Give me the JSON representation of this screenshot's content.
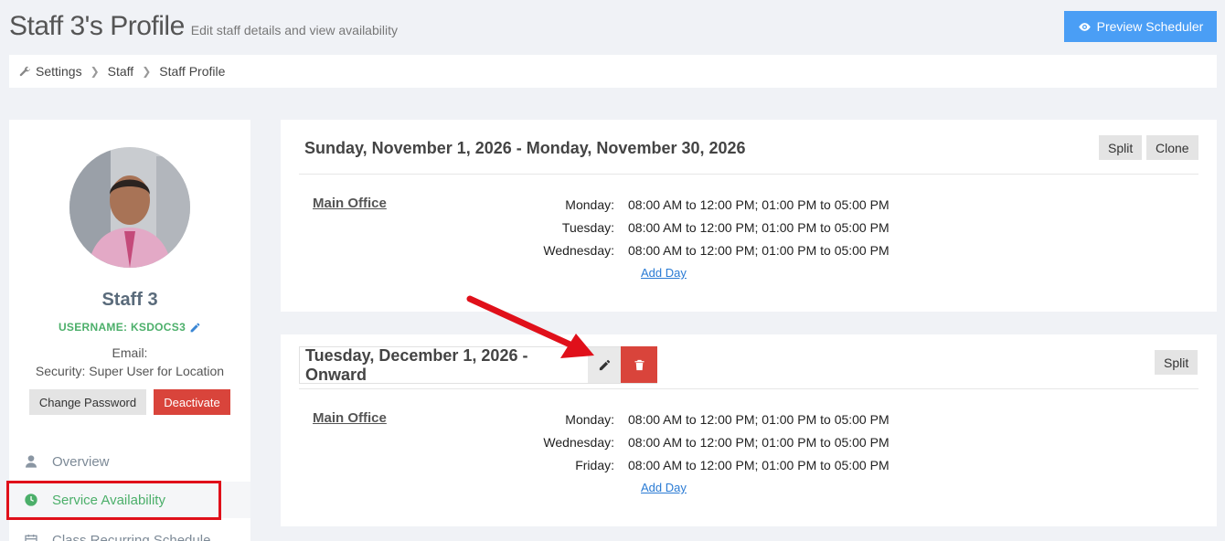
{
  "header": {
    "title": "Staff 3's Profile",
    "subtitle": "Edit staff details and view availability",
    "preview_button": "Preview Scheduler"
  },
  "breadcrumb": [
    "Settings",
    "Staff",
    "Staff Profile"
  ],
  "profile": {
    "name": "Staff 3",
    "username": "USERNAME: KSDOCS3",
    "email": "Email:",
    "security": "Security: Super User for Location",
    "change_password": "Change Password",
    "deactivate": "Deactivate"
  },
  "nav": [
    {
      "label": "Overview",
      "icon": "user-icon"
    },
    {
      "label": "Service Availability",
      "icon": "clock-icon",
      "active": true
    },
    {
      "label": "Class Recurring Schedule",
      "icon": "calendar-icon"
    }
  ],
  "schedules": [
    {
      "range": "Sunday, November 1, 2026 - Monday, November 30, 2026",
      "split": "Split",
      "clone": "Clone",
      "location": "Main Office",
      "days": [
        {
          "day": "Monday:",
          "hours": "08:00 AM to 12:00 PM; 01:00 PM to 05:00 PM"
        },
        {
          "day": "Tuesday:",
          "hours": "08:00 AM to 12:00 PM; 01:00 PM to 05:00 PM"
        },
        {
          "day": "Wednesday:",
          "hours": "08:00 AM to 12:00 PM; 01:00 PM to 05:00 PM"
        }
      ],
      "add_day": "Add Day"
    },
    {
      "range": "Tuesday, December 1, 2026 - Onward",
      "split": "Split",
      "location": "Main Office",
      "days": [
        {
          "day": "Monday:",
          "hours": "08:00 AM to 12:00 PM; 01:00 PM to 05:00 PM"
        },
        {
          "day": "Wednesday:",
          "hours": "08:00 AM to 12:00 PM; 01:00 PM to 05:00 PM"
        },
        {
          "day": "Friday:",
          "hours": "08:00 AM to 12:00 PM; 01:00 PM to 05:00 PM"
        }
      ],
      "add_day": "Add Day"
    }
  ],
  "colors": {
    "accent_blue": "#4a9ef5",
    "danger_red": "#d9443b",
    "success_green": "#4caf6a",
    "annotation_red": "#e0101a"
  }
}
